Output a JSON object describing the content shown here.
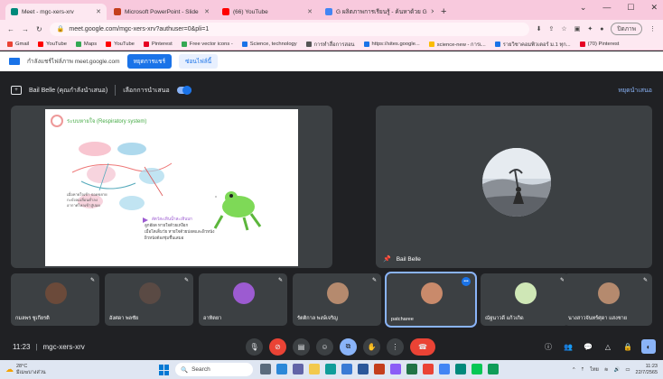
{
  "browser": {
    "tabs": [
      {
        "label": "Meet - mgc-xers-xrv",
        "fav_color": "#00897b",
        "active": true
      },
      {
        "label": "Microsoft PowerPoint - Slide",
        "fav_color": "#c43e1c",
        "active": false
      },
      {
        "label": "(66) YouTube",
        "fav_color": "#ff0000",
        "active": false
      },
      {
        "label": "G ผลิตภาพการเรียนรู้ - ค้นหาด้วย G",
        "fav_color": "#4285f4",
        "active": false
      }
    ],
    "new_tab": "+",
    "url": "meet.google.com/mgc-xers-xrv?authuser=0&pli=1",
    "profile_label": "ปิดภาพ",
    "bookmarks": [
      {
        "label": "Gmail",
        "color": "#ea4335"
      },
      {
        "label": "YouTube",
        "color": "#ff0000"
      },
      {
        "label": "Maps",
        "color": "#34a853"
      },
      {
        "label": "YouTube",
        "color": "#ff0000"
      },
      {
        "label": "Pinterest",
        "color": "#e60023"
      },
      {
        "label": "Free vector icons -",
        "color": "#34a853"
      },
      {
        "label": "Science, technology",
        "color": "#1a73e8"
      },
      {
        "label": "การทำสื่อการสอน",
        "color": "#555555"
      },
      {
        "label": "https://sites.google...",
        "color": "#1a73e8"
      },
      {
        "label": "science-new - การเ...",
        "color": "#fbbc04"
      },
      {
        "label": "รายวิชาคอมพิวเตอร์ ม.1 ทุก...",
        "color": "#1a73e8"
      },
      {
        "label": "(70) Pinterest",
        "color": "#e60023"
      }
    ]
  },
  "infobar": {
    "text": "กำลังแชร์ไฟล์ภาพ meet.google.com",
    "primary_button": "หยุดการแชร์",
    "secondary_button": "ซ่อนไฟล์นี้"
  },
  "meet": {
    "presenter_label": "Bail Belle (คุณกำลังนำเสนอ)",
    "presenting_label": "เลือกการนำเสนอ",
    "stop_presenting": "หยุดนำเสนอ",
    "slide": {
      "title": "ระบบหายใจ (Respiratory system)",
      "side_notes": [
        "เมื่อหายใจเข้า ปอดขยาย",
        "กะบังลมเลื่อนต่ำลง",
        "อากาศไหลเข้าสู่ปอด"
      ],
      "heading": "สัตว์สะเทินน้ำสะเทินบก",
      "bullets": [
        "ลูกอ๊อด หายใจด้วยเหงือก",
        "เมื่อโตเต็มวัย หายใจด้วยปอดและผิวหนัง",
        "ผิวหนังต้องชุ่มชื้นเสมอ"
      ]
    },
    "spotlight_name": "Bail Belle",
    "participants": [
      {
        "name": "กมลพร ชูเกียรติ",
        "muted": true,
        "face": "#6b4a3a"
      },
      {
        "name": "อังศดา พลชัย",
        "muted": true,
        "face": "#5a4a44"
      },
      {
        "name": "อาทิตยา",
        "muted": true,
        "face": "#9c5bd1"
      },
      {
        "name": "รัตติกาล พงษ์เจริญ",
        "muted": true,
        "face": "#b58a6e"
      },
      {
        "name": "patcharee",
        "muted": false,
        "face": "#c98a6b"
      },
      {
        "name": "ณัฐนาวดี แก้วเกิด",
        "muted": true,
        "face": "#cfe7b6"
      },
      {
        "name": "นางสาวจันทร์ศุดา แสงชาย",
        "muted": true,
        "face": "#b58a6e"
      }
    ],
    "meeting_time": "11:23",
    "meeting_code": "mgc-xers-xrv"
  },
  "taskbar": {
    "weather_temp": "28°C",
    "weather_desc": "มีเมฆบางส่วน",
    "search_placeholder": "Search",
    "time": "11:23",
    "date": "22/7/2565",
    "lang": "ไทย"
  }
}
